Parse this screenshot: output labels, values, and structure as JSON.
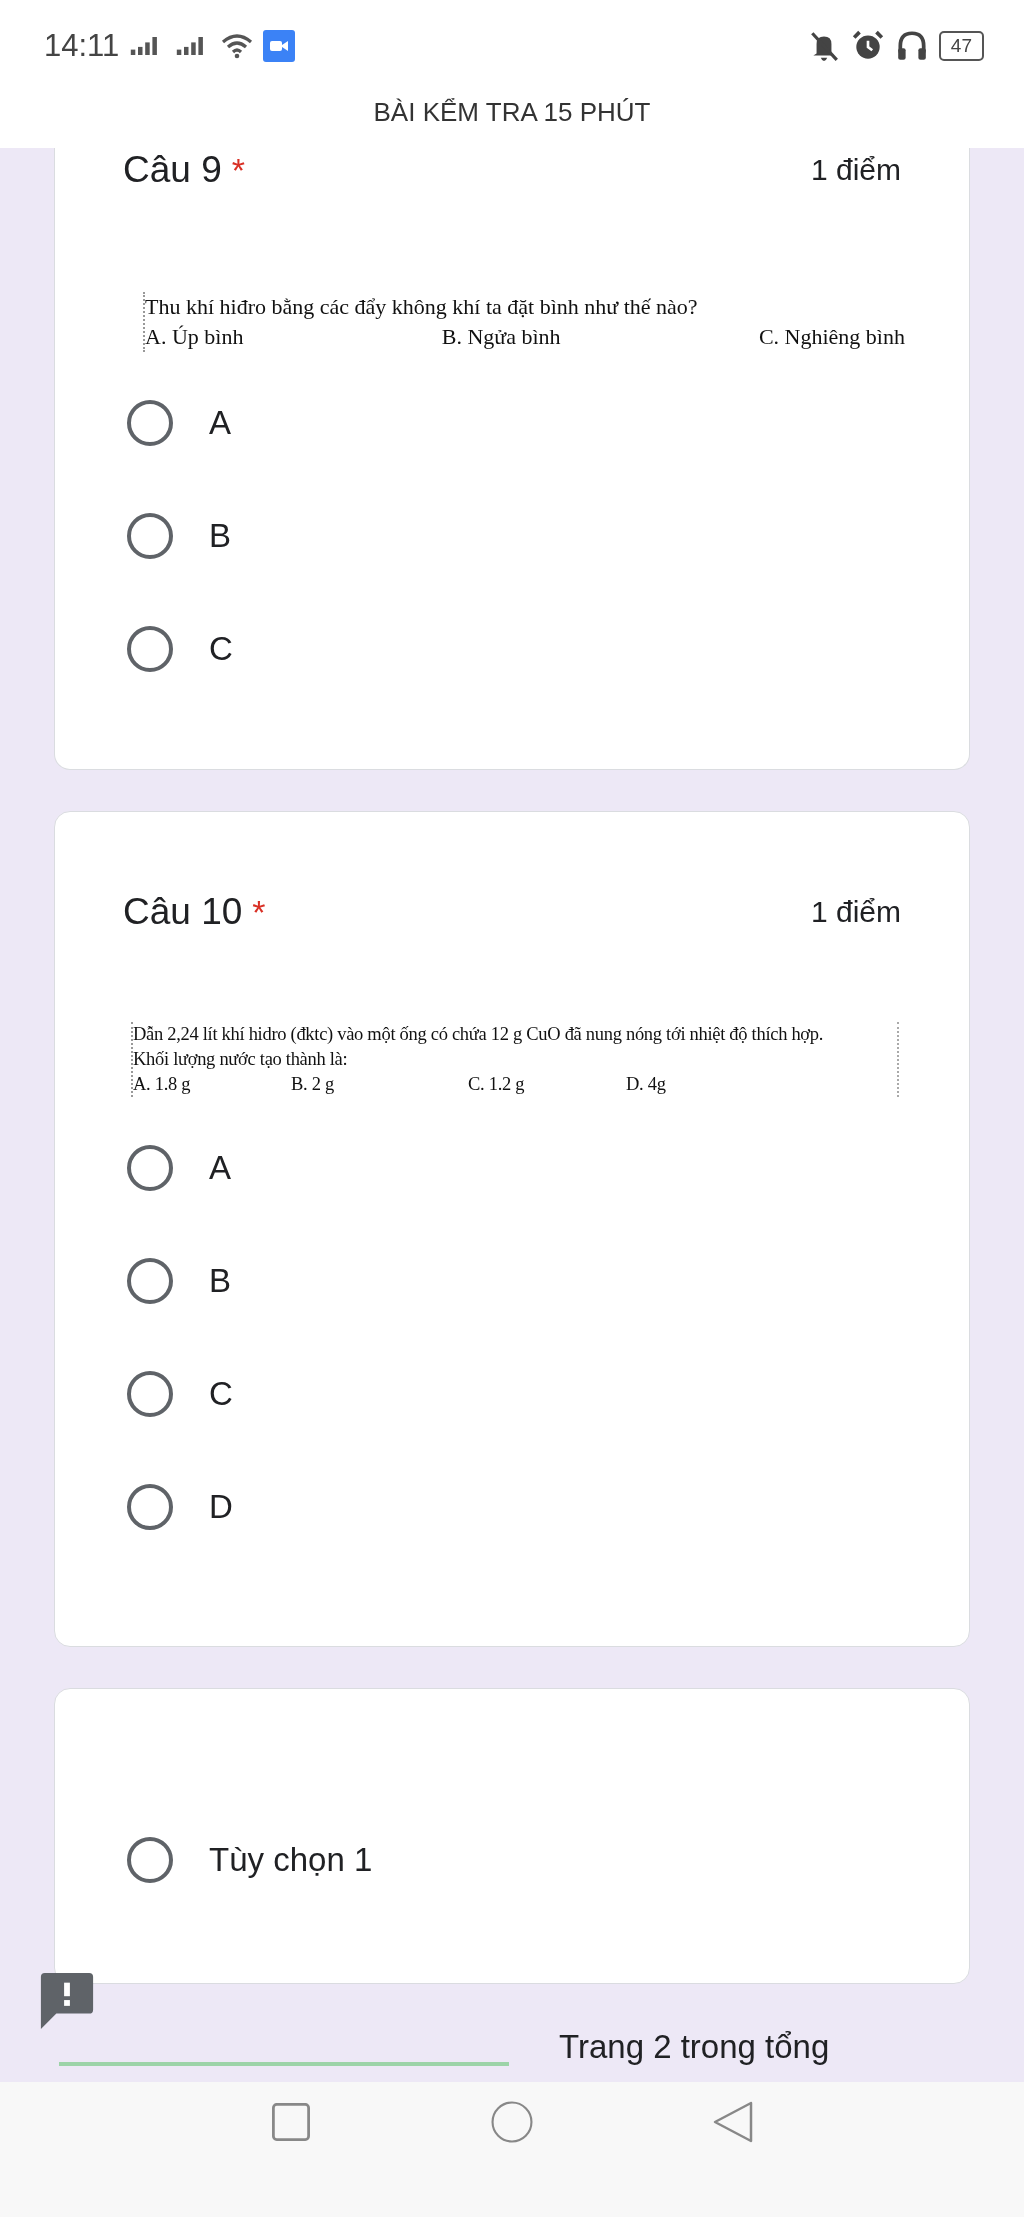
{
  "status_bar": {
    "time": "14:11",
    "battery": "47"
  },
  "form_title": "BÀI KỂM TRA 15 PHÚT",
  "questions": [
    {
      "title": "Câu 9",
      "required_mark": "*",
      "points": "1 điểm",
      "prompt": {
        "lines": [
          "Thu khí hiđro bằng các đẩy không khí ta đặt bình như thế nào?"
        ],
        "choices": [
          "A. Úp bình",
          "B. Ngửa bình",
          "C. Nghiêng bình"
        ]
      },
      "options": [
        {
          "label": "A",
          "selected": false
        },
        {
          "label": "B",
          "selected": false
        },
        {
          "label": "C",
          "selected": false
        }
      ]
    },
    {
      "title": "Câu 10",
      "required_mark": "*",
      "points": "1 điểm",
      "prompt": {
        "lines": [
          "Dẫn 2,24 lít khí hidro (đktc) vào một ống có chứa 12 g CuO đã nung nóng tới nhiệt độ thích hợp.",
          "Khối lượng nước tạo thành là:"
        ],
        "choices": [
          "A. 1.8 g",
          "B. 2 g",
          "C. 1.2 g",
          "D. 4g"
        ]
      },
      "options": [
        {
          "label": "A",
          "selected": false
        },
        {
          "label": "B",
          "selected": false
        },
        {
          "label": "C",
          "selected": false
        },
        {
          "label": "D",
          "selected": false
        }
      ]
    }
  ],
  "extra_question": {
    "options": [
      {
        "label": "Tùy chọn 1",
        "selected": false
      }
    ]
  },
  "footer": {
    "progress": {
      "level": 1
    },
    "page_text": "Trang 2 trong tổng"
  }
}
